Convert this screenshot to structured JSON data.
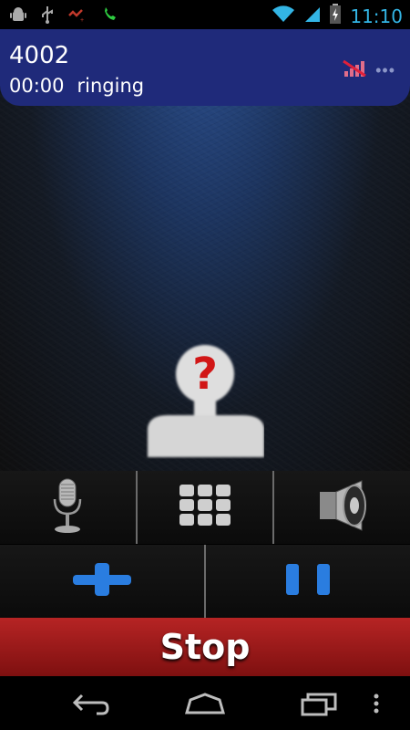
{
  "status_bar": {
    "time": "11:10",
    "left_icons": [
      "android-icon",
      "usb-icon",
      "missed-call-icon",
      "phone-active-icon"
    ],
    "right_icons": [
      "wifi-icon",
      "cell-signal-icon",
      "battery-charging-icon"
    ]
  },
  "call": {
    "number": "4002",
    "timer": "00:00",
    "state": "ringing",
    "icons": [
      "no-signal-icon",
      "more-dots-icon"
    ]
  },
  "avatar": {
    "symbol": "?"
  },
  "controls": {
    "row1": [
      {
        "name": "microphone-button",
        "icon": "microphone-icon"
      },
      {
        "name": "dialpad-button",
        "icon": "dialpad-icon"
      },
      {
        "name": "speaker-button",
        "icon": "speaker-icon"
      }
    ],
    "row2": [
      {
        "name": "add-call-button",
        "icon": "plus-icon"
      },
      {
        "name": "hold-button",
        "icon": "pause-icon"
      }
    ]
  },
  "stop": {
    "label": "Stop"
  },
  "nav": {
    "buttons": [
      "back-icon",
      "home-icon",
      "recents-icon",
      "menu-icon"
    ]
  },
  "colors": {
    "accent": "#33b5e5",
    "header": "#1f2a7a",
    "stop": "#a01a1a",
    "blue_icon": "#2a7de0"
  }
}
